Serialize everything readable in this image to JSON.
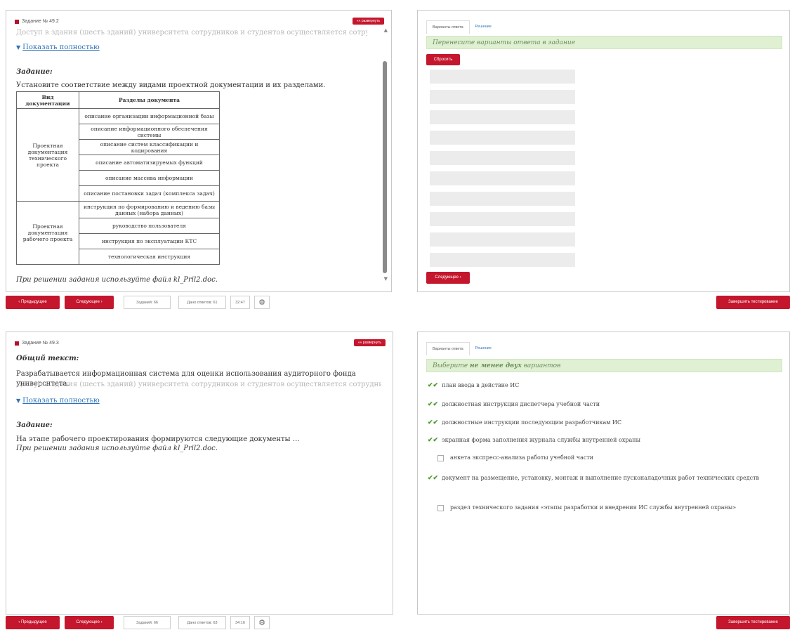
{
  "top": {
    "question": {
      "title": "Задание № 49.2",
      "collapse_label": "«« развернуть",
      "faded_text": "Доступ в здания (шесть зданий) университета сотрудников и студентов осуществляется сотрудниками",
      "show_more": "Показать полностью",
      "task_label": "Задание:",
      "task_text": "Установите соответствие между видами проектной документации и их разделами.",
      "table": {
        "headers": [
          "Вид документации",
          "Разделы документа"
        ],
        "groups": [
          {
            "kind": "Проектная документация технического проекта",
            "sections": [
              "описание организации информационной базы",
              "описание информационного обеспечения системы",
              "описание систем классификации и кодирования",
              "описание автоматизируемых функций",
              "описание массива информации",
              "описание постановки задач (комплекса задач)"
            ]
          },
          {
            "kind": "Проектная документация рабочего проекта",
            "sections": [
              "инструкция по формированию и ведению базы данных (набора данных)",
              "руководство пользователя",
              "инструкция по эксплуатации КТС",
              "технологическая инструкция"
            ]
          }
        ]
      },
      "file_note": "При решении задания используйте файл kl_Pril2.doc."
    },
    "answer": {
      "tabs": [
        "Варианты ответа",
        "Решение"
      ],
      "hint": "Перенесите варианты ответа в задание",
      "reset_label": "Сбросить",
      "next_label": "Следующее ›"
    },
    "bottom": {
      "prev": "‹ Предыдущее",
      "next": "Следующее ›",
      "tasks": "Заданий: 66",
      "answers": "Дано ответов: 61",
      "time": "32:47",
      "finish": "Завершить тестирование"
    }
  },
  "bottomq": {
    "question": {
      "title": "Задание № 49.3",
      "collapse_label": "«« развернуть",
      "general_label": "Общий текст:",
      "general_text": "Разрабатывается информационная система для оценки использования аудиторного фонда университета.",
      "faded_text": "Доступ в здания (шесть зданий) университета сотрудников и студентов осуществляется сотрудниками",
      "show_more": "Показать полностью",
      "task_label": "Задание:",
      "task_text": "На этапе рабочего проектирования формируются следующие документы …",
      "file_note": "При решении задания используйте файл kl_Pril2.doc."
    },
    "answer": {
      "tabs": [
        "Варианты ответа",
        "Решение"
      ],
      "hint_prefix": "Выберите ",
      "hint_bold": "не менее двух",
      "hint_suffix": " вариантов",
      "options": [
        {
          "text": "план ввода в действие ИС",
          "checked": true
        },
        {
          "text": "должностная инструкция диспетчера учебной части",
          "checked": true
        },
        {
          "text": "должностные инструкции последующим разработчикам ИС",
          "checked": true
        },
        {
          "text": "экранная форма заполнения журнала службы внутренней охраны",
          "checked": true
        },
        {
          "text": "анкета экспресс-анализа работы учебной части",
          "checked": false
        },
        {
          "text": "документ на размещение, установку, монтаж и выполнение пусконаладочных работ технических средств",
          "checked": true
        },
        {
          "text": "раздел технического задания «этапы разработки и внедрения ИС службы внутренней охраны»",
          "checked": false
        }
      ]
    },
    "bottom": {
      "prev": "‹ Предыдущее",
      "next": "Следующее ›",
      "tasks": "Заданий: 66",
      "answers": "Дано ответов: 63",
      "time": "34:16",
      "finish": "Завершить тестирование"
    }
  },
  "icons": {
    "settings": "gear-icon",
    "scroll_up": "chevron-up-icon",
    "scroll_down": "chevron-down-icon",
    "check": "double-check-icon"
  },
  "colors": {
    "accent": "#c4162d",
    "hint_bg": "#dff0d3",
    "check": "#4a9a2c",
    "link": "#2f72b8"
  }
}
